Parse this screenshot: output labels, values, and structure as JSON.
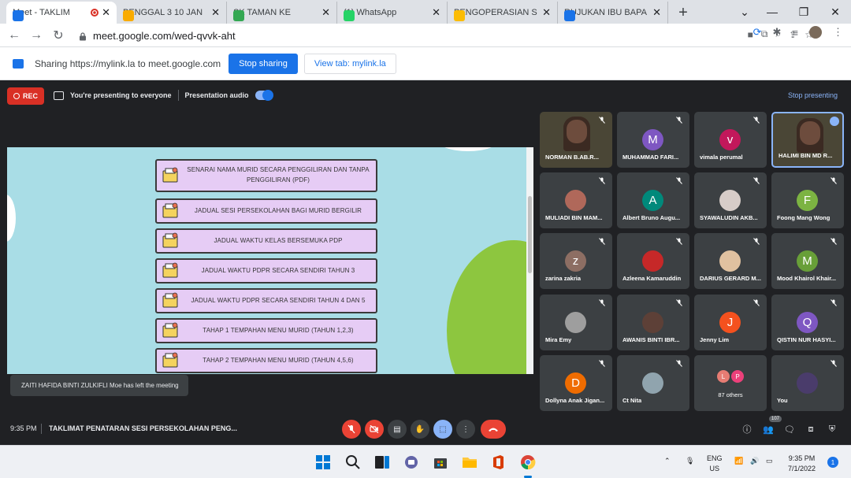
{
  "browser": {
    "tabs": [
      {
        "label": "Meet - TAKLIM",
        "color": "#1a73e8",
        "active": true
      },
      {
        "label": "PENGGAL 3 10 JAN",
        "color": "#f9ab00"
      },
      {
        "label": "SK TAMAN KE",
        "color": "#34a853"
      },
      {
        "label": "(1) WhatsApp",
        "color": "#25d366"
      },
      {
        "label": "PENGOPERASIAN S",
        "color": "#fbbc04"
      },
      {
        "label": "RUJUKAN IBU BAPA",
        "color": "#1a73e8"
      }
    ],
    "url": "meet.google.com/wed-qvvk-aht"
  },
  "sharebar": {
    "text": "Sharing https://mylink.la to meet.google.com",
    "stop_label": "Stop sharing",
    "view_label": "View tab: mylink.la"
  },
  "meet_top": {
    "rec_label": "REC",
    "presenting_text": "You're presenting to everyone",
    "audio_label": "Presentation audio",
    "stop_presenting_label": "Stop presenting"
  },
  "slide": {
    "buttons": [
      {
        "text": "SENARAI NAMA MURID SECARA PENGGILIRAN DAN TANPA PENGGILIRAN (PDF)"
      },
      {
        "text": "JADUAL SESI PERSEKOLAHAN BAGI MURID BERGILIR"
      },
      {
        "text": "JADUAL WAKTU KELAS BERSEMUKA PDP"
      },
      {
        "text": "JADUAL WAKTU PDPR SECARA SENDIRI TAHUN 3"
      },
      {
        "text": "JADUAL WAKTU PDPR SECARA SENDIRI TAHUN 4 DAN 5"
      },
      {
        "text": "TAHAP 1 TEMPAHAN MENU MURID (TAHUN 1,2,3)"
      },
      {
        "text": "TAHAP 2 TEMPAHAN MENU MURID (TAHUN 4,5,6)"
      }
    ]
  },
  "toast": "ZAITI HAFIDA BINTI ZULKIFLI Moe has left the meeting",
  "participants": [
    {
      "name": "NORMAN B.AB.R...",
      "type": "video"
    },
    {
      "name": "MUHAMMAD FARI...",
      "initial": "M",
      "color": "#7e57c2"
    },
    {
      "name": "vimala perumal",
      "initial": "v",
      "color": "#c2185b"
    },
    {
      "name": "HALIMI BIN MD R...",
      "type": "video",
      "speaking": true
    },
    {
      "name": "MULIADI BIN MAM...",
      "type": "photo"
    },
    {
      "name": "Albert Bruno Augu...",
      "initial": "A",
      "color": "#00897b"
    },
    {
      "name": "SYAWALUDIN AKB...",
      "type": "photo"
    },
    {
      "name": "Foong Mang Wong",
      "initial": "F",
      "color": "#7cb342"
    },
    {
      "name": "zarina zakria",
      "initial": "z",
      "color": "#8d6e63"
    },
    {
      "name": "Azleena Kamaruddin",
      "type": "photo"
    },
    {
      "name": "DARIUS GERARD M...",
      "type": "photo"
    },
    {
      "name": "Mood Khairol Khair...",
      "initial": "M",
      "color": "#689f38"
    },
    {
      "name": "Mira Emy",
      "type": "photo"
    },
    {
      "name": "AWANIS BINTI IBR...",
      "type": "photo"
    },
    {
      "name": "Jenny Lim",
      "initial": "J",
      "color": "#f4511e"
    },
    {
      "name": "QISTIN NUR HASYI...",
      "initial": "Q",
      "color": "#7e57c2"
    },
    {
      "name": "Dollyna Anak Jigan...",
      "initial": "D",
      "color": "#ef6c00"
    },
    {
      "name": "Ct Nita",
      "type": "photo"
    },
    {
      "name": "87 others",
      "type": "others"
    },
    {
      "name": "You",
      "type": "photo"
    }
  ],
  "others_initials": [
    "L",
    "P"
  ],
  "bottom": {
    "time": "9:35 PM",
    "meeting_title": "TAKLIMAT PENATARAN SESI PERSEKOLAHAN PENG...",
    "people_count": "107"
  },
  "taskbar": {
    "lang": "ENG",
    "region": "US",
    "time": "9:35 PM",
    "date": "7/1/2022",
    "notifications": "1"
  }
}
